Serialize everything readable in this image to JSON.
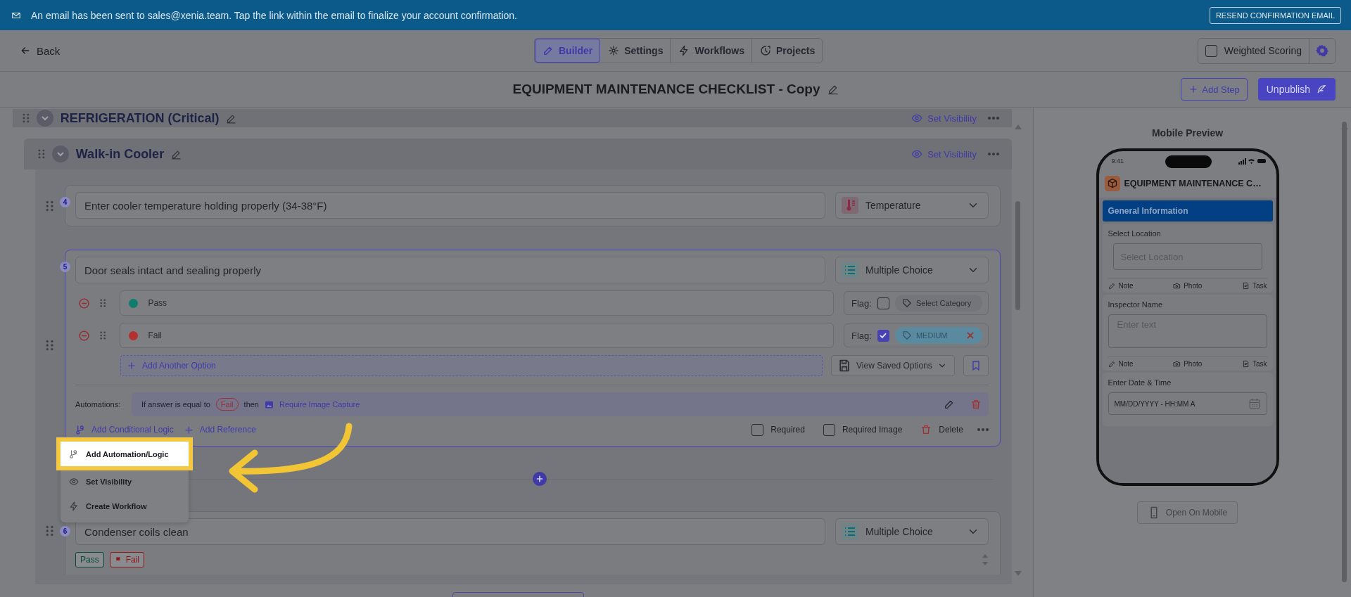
{
  "banner": {
    "message": "An email has been sent to sales@xenia.team. Tap the link within the email to finalize your account confirmation.",
    "button": "RESEND CONFIRMATION EMAIL"
  },
  "header": {
    "back": "Back",
    "tabs": [
      {
        "label": "Builder",
        "kind": "builder",
        "selected": true
      },
      {
        "label": "Settings",
        "kind": "settings",
        "selected": false
      },
      {
        "label": "Workflows",
        "kind": "workflows",
        "selected": false
      },
      {
        "label": "Projects",
        "kind": "projects",
        "selected": false
      }
    ],
    "weighted_scoring": {
      "label": "Weighted Scoring",
      "checked": false
    }
  },
  "title": "EQUIPMENT MAINTENANCE CHECKLIST - Copy",
  "actions": {
    "add_step": "Add Step",
    "publish": "Unpublish"
  },
  "builder": {
    "sections": [
      {
        "title": "REFRIGERATION (Critical)",
        "visibility": "Set Visibility"
      },
      {
        "title": "Walk-in Cooler",
        "visibility": "Set Visibility"
      }
    ],
    "questions": [
      {
        "number": "4",
        "kind": "temperature",
        "text": "Enter cooler temperature holding properly (34-38°F)",
        "type": "Temperature",
        "selected": false,
        "expanded": false
      },
      {
        "number": "5",
        "kind": "multiple_choice",
        "text": "Door seals intact and sealing properly",
        "type": "Multiple Choice",
        "selected": true,
        "expanded": true,
        "options": [
          {
            "label": "Pass",
            "color": "#0f7d6c",
            "flag_label": "Flag:",
            "flagged": false,
            "category": "Select Category"
          },
          {
            "label": "Fail",
            "color": "#b3312f",
            "flag_label": "Flag:",
            "flagged": true,
            "category": "MEDIUM"
          }
        ],
        "add_option": "Add Another Option",
        "saved_options": "View Saved Options",
        "automation": {
          "label": "Automations:",
          "condition": "If answer is equal to",
          "answer": "Fail",
          "then": "then",
          "action": "Require Image Capture"
        },
        "links": [
          {
            "label": "Add Conditional Logic",
            "kind": "logic"
          },
          {
            "label": "Add Reference",
            "kind": "reference"
          }
        ],
        "required": {
          "label": "Required",
          "checked": false
        },
        "required_image": {
          "label": "Required Image",
          "checked": false
        },
        "delete": "Delete"
      },
      {
        "number": "6",
        "kind": "multiple_choice",
        "text": "Condenser coils clean",
        "type": "Multiple Choice",
        "selected": false,
        "expanded": false,
        "chips": [
          {
            "label": "Pass",
            "color": "#064a34",
            "kind": "plain"
          },
          {
            "label": "Fail",
            "color": "#8e1616",
            "kind": "flag"
          }
        ]
      }
    ]
  },
  "menu": {
    "items": [
      {
        "label": "Add Automation/Logic",
        "kind": "logic",
        "highlighted": true
      },
      {
        "label": "Set Visibility",
        "kind": "visibility",
        "highlighted": false
      },
      {
        "label": "Create Workflow",
        "kind": "workflow",
        "highlighted": false
      }
    ]
  },
  "preview": {
    "heading": "Mobile Preview",
    "time": "9:41",
    "title": "EQUIPMENT MAINTENANCE C…",
    "section": "General Information",
    "fields": [
      {
        "kind": "select",
        "label": "Select Location",
        "placeholder": "Select Location",
        "actions": [
          "Note",
          "Photo",
          "Task"
        ]
      },
      {
        "kind": "text",
        "label": "Inspector Name",
        "placeholder": "Enter text",
        "actions": [
          "Note",
          "Photo",
          "Task"
        ]
      },
      {
        "kind": "datetime",
        "label": "Enter Date & Time",
        "placeholder": "MM/DD/YYYY - HH:MM A"
      }
    ],
    "open_button": "Open On Mobile"
  }
}
